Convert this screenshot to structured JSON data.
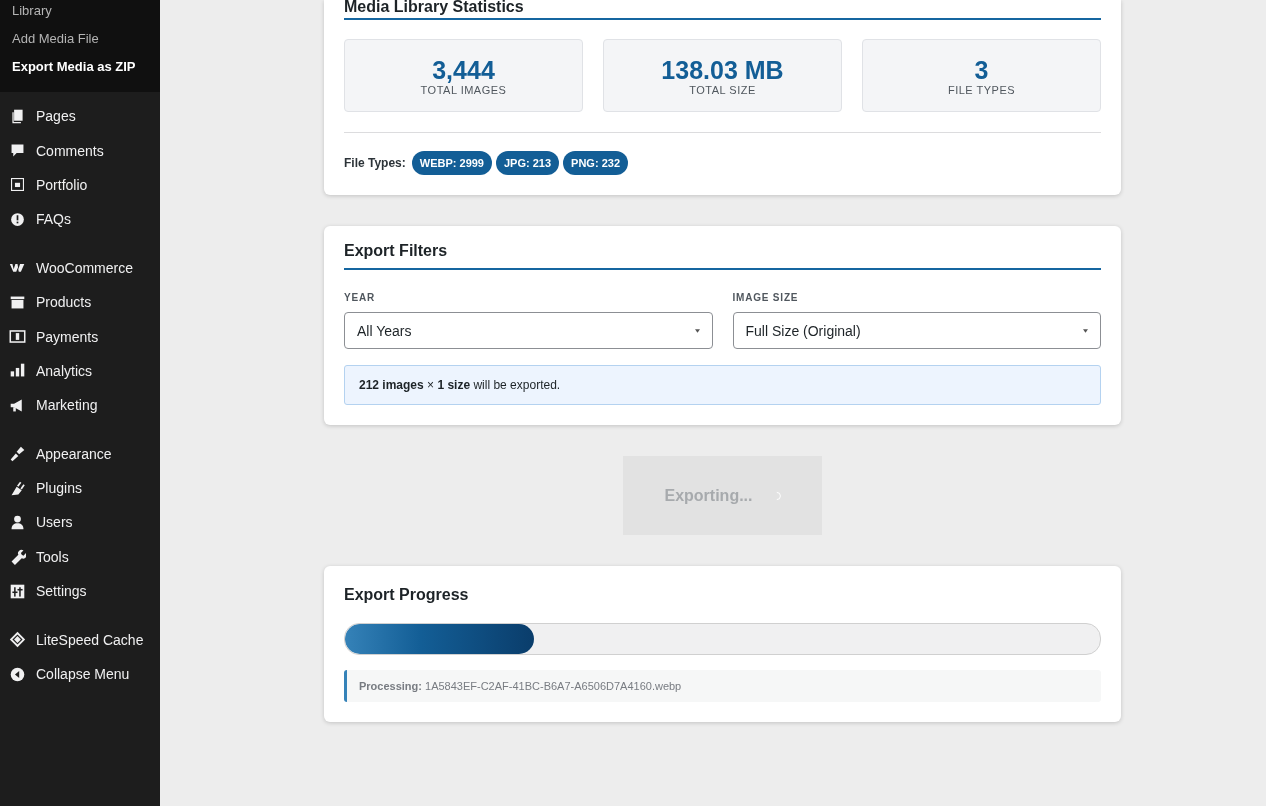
{
  "sidebar": {
    "submenu": [
      {
        "label": "Library",
        "selected": false
      },
      {
        "label": "Add Media File",
        "selected": false
      },
      {
        "label": "Export Media as ZIP",
        "selected": true
      }
    ],
    "groups": [
      {
        "items": [
          {
            "label": "Pages"
          },
          {
            "label": "Comments"
          },
          {
            "label": "Portfolio"
          },
          {
            "label": "FAQs"
          }
        ]
      },
      {
        "items": [
          {
            "label": "WooCommerce"
          },
          {
            "label": "Products"
          },
          {
            "label": "Payments"
          },
          {
            "label": "Analytics"
          },
          {
            "label": "Marketing"
          }
        ]
      },
      {
        "items": [
          {
            "label": "Appearance"
          },
          {
            "label": "Plugins"
          },
          {
            "label": "Users"
          },
          {
            "label": "Tools"
          },
          {
            "label": "Settings"
          }
        ]
      },
      {
        "items": [
          {
            "label": "LiteSpeed Cache"
          },
          {
            "label": "Collapse Menu"
          }
        ]
      }
    ]
  },
  "statistics": {
    "title": "Media Library Statistics",
    "stats": [
      {
        "value": "3,444",
        "label": "TOTAL IMAGES"
      },
      {
        "value": "138.03 MB",
        "label": "TOTAL SIZE"
      },
      {
        "value": "3",
        "label": "FILE TYPES"
      }
    ],
    "file_types_label": "File Types:",
    "file_types": [
      "WEBP: 2999",
      "JPG: 213",
      "PNG: 232"
    ]
  },
  "filters": {
    "title": "Export Filters",
    "fields": [
      {
        "label": "YEAR",
        "value": "All Years"
      },
      {
        "label": "IMAGE SIZE",
        "value": "Full Size (Original)"
      }
    ],
    "notice": "**212 images** × **1 size** will be exported."
  },
  "export_button": {
    "label": "Exporting...",
    "disabled": true
  },
  "progress": {
    "title": "Export Progress",
    "level": 0.25,
    "status_label": "Processing:",
    "status_file": "1A5843EF-C2AF-41BC-B6A7-A6506D7A4160.webp"
  }
}
